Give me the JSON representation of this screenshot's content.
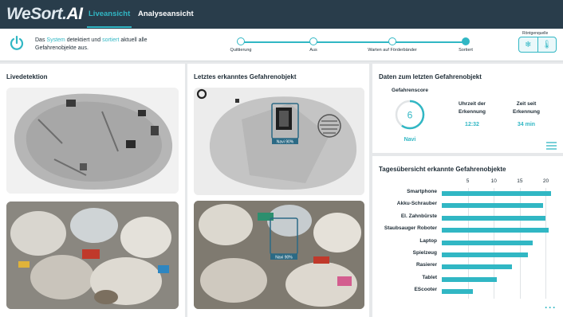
{
  "app": {
    "logo_main": "WeSort.",
    "logo_ai": "AI",
    "tabs": [
      {
        "label": "Liveansicht",
        "active": true
      },
      {
        "label": "Analyseansicht",
        "active": false
      }
    ]
  },
  "status": {
    "text_1": "Das ",
    "text_system": "System",
    "text_2": " detektiert und ",
    "text_sortiert": "sortiert",
    "text_3": " aktuell alle Gefahrenobjekte aus.",
    "steps": [
      "Quittierung",
      "Aus",
      "Warten auf Förderbänder",
      "Sortiert"
    ],
    "active_step": 3,
    "roentgen_label": "Röntgenquelle"
  },
  "panels": {
    "live_title": "Livedetektion",
    "last_title": "Letztes erkanntes Gefahrenobjekt",
    "detection_label": "Navi 90%",
    "info_title": "Daten zum letzten Gefahrenobjekt",
    "score_label": "Gefahrenscore",
    "score_value": "6",
    "score_fraction": 0.6,
    "score_object": "Navi",
    "time_label_1": "Uhrzeit der",
    "time_label_2": "Erkennung",
    "time_value": "12:32",
    "since_label_1": "Zeit seit",
    "since_label_2": "Erkennung",
    "since_value": "34 min",
    "chart_title": "Tagesübersicht erkannte Gefahrenobjekte"
  },
  "colors": {
    "accent": "#31b7c4",
    "nav": "#293d4b"
  },
  "chart_data": {
    "type": "bar",
    "orientation": "horizontal",
    "categories": [
      "Smartphone",
      "Akku-Schrauber",
      "El. Zahnbürste",
      "Staubsauger Roboter",
      "Laptop",
      "Spielzeug",
      "Rasierer",
      "Tablet",
      "EScooter"
    ],
    "values": [
      21,
      19.5,
      20,
      20.5,
      17.5,
      16.5,
      13.5,
      10.5,
      6
    ],
    "ticks": [
      5,
      10,
      15,
      20
    ],
    "xlim": [
      0,
      21
    ],
    "grid": true
  }
}
